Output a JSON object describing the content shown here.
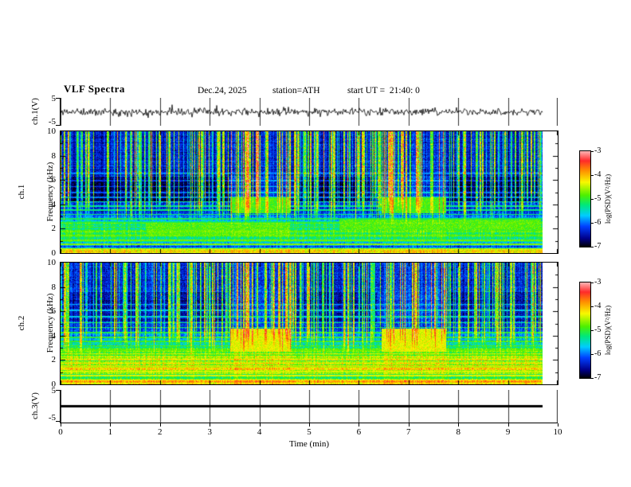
{
  "header": {
    "title": "VLF Spectra",
    "date": "Dec.24, 2025",
    "station": "station=ATH",
    "start_ut": "start UT =  21:40: 0"
  },
  "xaxis": {
    "label": "Time (min)",
    "ticks": [
      "0",
      "1",
      "2",
      "3",
      "4",
      "5",
      "6",
      "7",
      "8",
      "9",
      "10"
    ]
  },
  "panels": {
    "wave1": {
      "ylabel": "ch.1(V)",
      "ytop": "5",
      "ybottom": "-5"
    },
    "spec1": {
      "channel": "ch.1",
      "ylabel": "Frequency (kHz)",
      "yticks": [
        "10",
        "8",
        "6",
        "4",
        "2",
        "0"
      ]
    },
    "spec2": {
      "channel": "ch.2",
      "ylabel": "Frequency (kHz)",
      "yticks": [
        "10",
        "8",
        "6",
        "4",
        "2",
        "0"
      ]
    },
    "wave3": {
      "ylabel": "ch.3(V)",
      "ytop": "5",
      "ybottom": "-5"
    }
  },
  "colorbar": {
    "label": "log(PSD)(V²/Hz)",
    "ticks": [
      "-3",
      "-4",
      "-5",
      "-6",
      "-7"
    ],
    "stops": [
      [
        -7.0,
        "#000005"
      ],
      [
        -6.65,
        "#00008c"
      ],
      [
        -6.15,
        "#0040ff"
      ],
      [
        -5.7,
        "#00ccff"
      ],
      [
        -5.25,
        "#00e87a"
      ],
      [
        -4.85,
        "#4cf000"
      ],
      [
        -4.3,
        "#f8f800"
      ],
      [
        -3.8,
        "#ff8c00"
      ],
      [
        -3.4,
        "#ff2a2a"
      ],
      [
        -3.0,
        "#ffb4b4"
      ]
    ]
  },
  "chart_data": [
    {
      "type": "line",
      "name": "ch1_waveform",
      "ylabel": "ch.1(V)",
      "ylim": [
        -5,
        5
      ],
      "x_minutes": [
        0,
        9.7
      ],
      "grid_minutes": true,
      "synthesis": {
        "seed": 11,
        "noise_v": 1.6,
        "spike_prob": 0.02,
        "spike_v": 2.0
      }
    },
    {
      "type": "heatmap",
      "name": "ch1_spectrogram",
      "channel": "ch.1",
      "xlabel": "Time (min)",
      "ylabel": "Frequency (kHz)",
      "zlabel": "log(PSD)(V²/Hz)",
      "xlim": [
        0,
        10
      ],
      "ylim": [
        0,
        10
      ],
      "zlim": [
        -7,
        -3
      ],
      "data_tmax": 9.7,
      "synthesis": {
        "seed": 42,
        "sigma": 0.38,
        "col_jitter": 0.5,
        "row_jitter_low": 0.28,
        "row_jitter_high": 0.15,
        "base": [
          [
            0,
            -4.1
          ],
          [
            0.3,
            -4.3
          ],
          [
            0.55,
            -6.2
          ],
          [
            0.9,
            -5.5
          ],
          [
            1.3,
            -5.0
          ],
          [
            2.5,
            -5.15
          ],
          [
            3.0,
            -5.95
          ],
          [
            3.5,
            -6.3
          ],
          [
            10,
            -6.4
          ]
        ],
        "lines": [
          0.35,
          0.75,
          1.1,
          1.45,
          1.8,
          2.15,
          2.5,
          2.85,
          3.2,
          3.55,
          3.9,
          4.25,
          4.6,
          5.0,
          5.5,
          6.0,
          6.55
        ],
        "line_a": -4.5,
        "line_b": -0.22,
        "streaks": {
          "count": 260,
          "boost_min": 0.7,
          "boost_max": 2.3
        },
        "active_windows": [
          [
            3.4,
            4.62
          ],
          [
            6.45,
            7.75
          ]
        ],
        "bright_blocks": [
          {
            "t": [
              3.4,
              4.62
            ],
            "f": [
              3.3,
              4.6
            ],
            "level": -4.9
          },
          {
            "t": [
              6.45,
              7.75
            ],
            "f": [
              3.3,
              4.6
            ],
            "level": -4.9
          },
          {
            "t": [
              1.7,
              4.6
            ],
            "f": [
              1.5,
              2.5
            ],
            "level": -4.85
          },
          {
            "t": [
              5.6,
              9.65
            ],
            "f": [
              1.9,
              2.8
            ],
            "level": -4.85
          }
        ],
        "dark_blocks": [
          {
            "t": [
              0.1,
              3.35
            ],
            "f": [
              4.3,
              6.3
            ],
            "delta": -0.45
          },
          {
            "t": [
              4.75,
              6.35
            ],
            "f": [
              4.3,
              6.3
            ],
            "delta": -0.45
          },
          {
            "t": [
              7.8,
              9.65
            ],
            "f": [
              4.3,
              6.3
            ],
            "delta": -0.45
          }
        ]
      }
    },
    {
      "type": "heatmap",
      "name": "ch2_spectrogram",
      "channel": "ch.2",
      "xlabel": "Time (min)",
      "ylabel": "Frequency (kHz)",
      "zlabel": "log(PSD)(V²/Hz)",
      "xlim": [
        0,
        10
      ],
      "ylim": [
        0,
        10
      ],
      "zlim": [
        -7,
        -3
      ],
      "data_tmax": 9.7,
      "synthesis": {
        "seed": 77,
        "sigma": 0.42,
        "col_jitter": 0.5,
        "row_jitter_low": 0.5,
        "row_jitter_high": 0.15,
        "base": [
          [
            0,
            -4.0
          ],
          [
            0.35,
            -4.2
          ],
          [
            0.6,
            -5.5
          ],
          [
            0.9,
            -4.6
          ],
          [
            1.7,
            -4.55
          ],
          [
            2.6,
            -4.85
          ],
          [
            3.3,
            -5.45
          ],
          [
            4.1,
            -5.95
          ],
          [
            4.7,
            -6.2
          ],
          [
            10,
            -6.35
          ]
        ],
        "lines": [
          0.35,
          0.75,
          1.1,
          1.45,
          1.8,
          2.15,
          2.5,
          2.85,
          3.2,
          3.55,
          3.9,
          4.3,
          4.7,
          5.1,
          5.6,
          6.1,
          6.6
        ],
        "line_a": -4.25,
        "line_b": -0.2,
        "streaks": {
          "count": 240,
          "boost_min": 0.7,
          "boost_max": 2.2
        },
        "active_windows": [
          [
            3.4,
            4.62
          ],
          [
            6.45,
            7.75
          ]
        ],
        "bright_blocks": [
          {
            "t": [
              3.4,
              4.62
            ],
            "f": [
              2.7,
              4.6
            ],
            "level": -4.35
          },
          {
            "t": [
              6.45,
              7.75
            ],
            "f": [
              2.7,
              4.6
            ],
            "level": -4.35
          }
        ],
        "dark_blocks": [
          {
            "t": [
              0.1,
              3.35
            ],
            "f": [
              5.2,
              7.6
            ],
            "delta": -0.25
          },
          {
            "t": [
              4.75,
              6.35
            ],
            "f": [
              5.2,
              7.6
            ],
            "delta": -0.25
          },
          {
            "t": [
              7.8,
              9.65
            ],
            "f": [
              5.2,
              7.6
            ],
            "delta": -0.25
          }
        ]
      }
    },
    {
      "type": "line",
      "name": "ch3_waveform",
      "ylabel": "ch.3(V)",
      "ylim": [
        -5,
        5
      ],
      "x_minutes": [
        0,
        9.7
      ],
      "grid_minutes": true,
      "constant_value": 0,
      "line_width": 3
    }
  ]
}
